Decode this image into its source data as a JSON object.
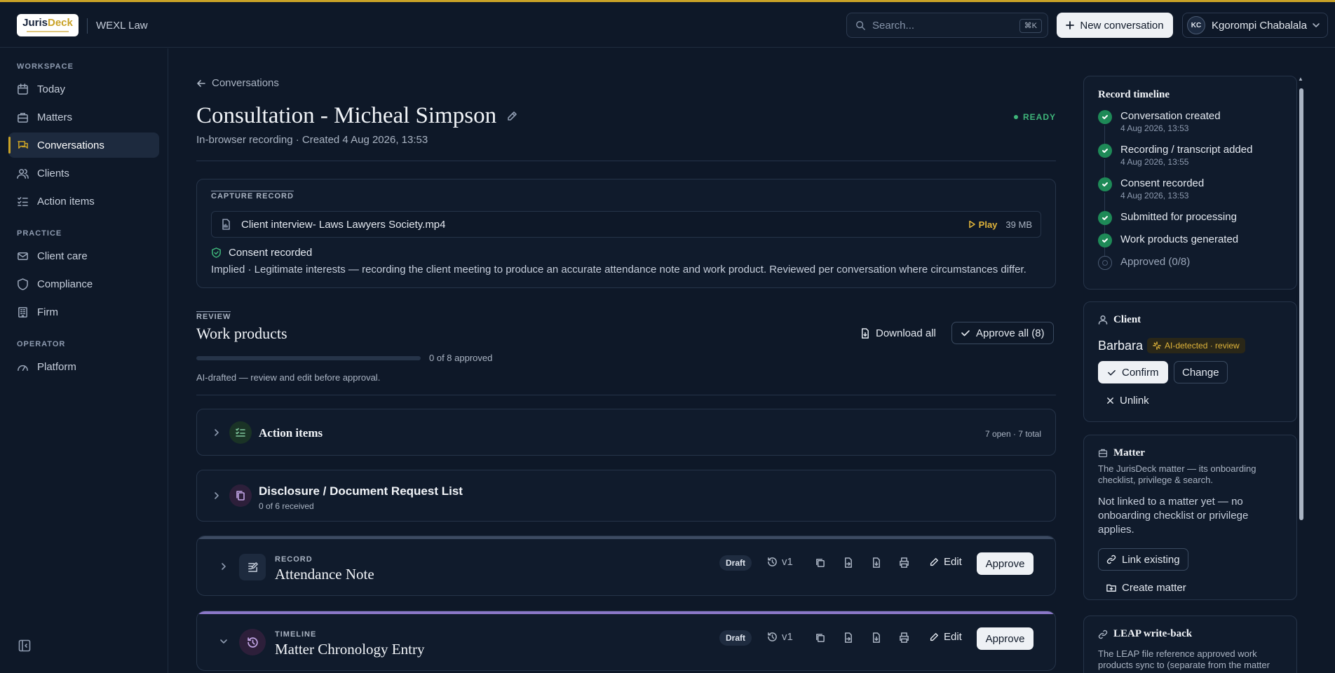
{
  "header": {
    "logo_text": "JurisDeck",
    "firm_name": "WEXL Law",
    "search_placeholder": "Search...",
    "search_shortcut": "⌘K",
    "new_conversation": "New conversation",
    "user_initials": "KC",
    "user_name": "Kgorompi Chabalala"
  },
  "sidebar": {
    "sections": [
      {
        "label": "WORKSPACE",
        "items": [
          "Today",
          "Matters",
          "Conversations",
          "Clients",
          "Action items"
        ]
      },
      {
        "label": "PRACTICE",
        "items": [
          "Client care",
          "Compliance",
          "Firm"
        ]
      },
      {
        "label": "OPERATOR",
        "items": [
          "Platform"
        ]
      }
    ],
    "active": "Conversations"
  },
  "page": {
    "back_label": "Conversations",
    "title": "Consultation - Micheal Simpson",
    "status": "READY",
    "subtitle": "In-browser recording · Created 4 Aug 2026, 13:53"
  },
  "capture": {
    "label": "CAPTURE RECORD",
    "file_name": "Client interview- Laws Lawyers Society.mp4",
    "play_label": "Play",
    "file_size": "39 MB",
    "consent_title": "Consent recorded",
    "consent_desc": "Implied · Legitimate interests — recording the client meeting to produce an accurate attendance note and work product. Reviewed per conversation where circumstances differ."
  },
  "review": {
    "label": "REVIEW",
    "title": "Work products",
    "download_all": "Download all",
    "approve_all": "Approve all (8)",
    "progress_fraction": 0,
    "progress_text": "0 of 8 approved",
    "note": "AI-drafted — review and edit before approval."
  },
  "rows": {
    "action_items": {
      "title": "Action items",
      "meta": "7 open · 7 total"
    },
    "disclosure": {
      "title": "Disclosure / Document Request List",
      "meta": "0 of 6 received"
    }
  },
  "work_products": [
    {
      "kicker": "RECORD",
      "name": "Attendance Note",
      "status": "Draft",
      "version": "v1",
      "edit": "Edit",
      "approve": "Approve",
      "accent": "#3d4b62"
    },
    {
      "kicker": "TIMELINE",
      "name": "Matter Chronology Entry",
      "status": "Draft",
      "version": "v1",
      "edit": "Edit",
      "approve": "Approve",
      "accent": "#8b78c8"
    }
  ],
  "timeline": {
    "title": "Record timeline",
    "items": [
      {
        "label": "Conversation created",
        "time": "4 Aug 2026, 13:53",
        "done": true
      },
      {
        "label": "Recording / transcript added",
        "time": "4 Aug 2026, 13:55",
        "done": true
      },
      {
        "label": "Consent recorded",
        "time": "4 Aug 2026, 13:53",
        "done": true
      },
      {
        "label": "Submitted for processing",
        "time": "",
        "done": true
      },
      {
        "label": "Work products generated",
        "time": "",
        "done": true
      },
      {
        "label": "Approved (0/8)",
        "time": "",
        "done": false
      }
    ]
  },
  "client_panel": {
    "title": "Client",
    "name": "Barbara",
    "badge": "AI-detected · review",
    "confirm": "Confirm",
    "change": "Change",
    "unlink": "Unlink"
  },
  "matter_panel": {
    "title": "Matter",
    "desc": "The JurisDeck matter — its onboarding checklist, privilege & search.",
    "status_text": "Not linked to a matter yet — no onboarding checklist or privilege applies.",
    "link_existing": "Link existing",
    "create_matter": "Create matter"
  },
  "leap_panel": {
    "title": "LEAP write-back",
    "desc": "The LEAP file reference approved work products sync to (separate from the matter"
  },
  "colors": {
    "accent_gold": "#c9a227",
    "success": "#3fb57a",
    "background": "#0e1828"
  }
}
